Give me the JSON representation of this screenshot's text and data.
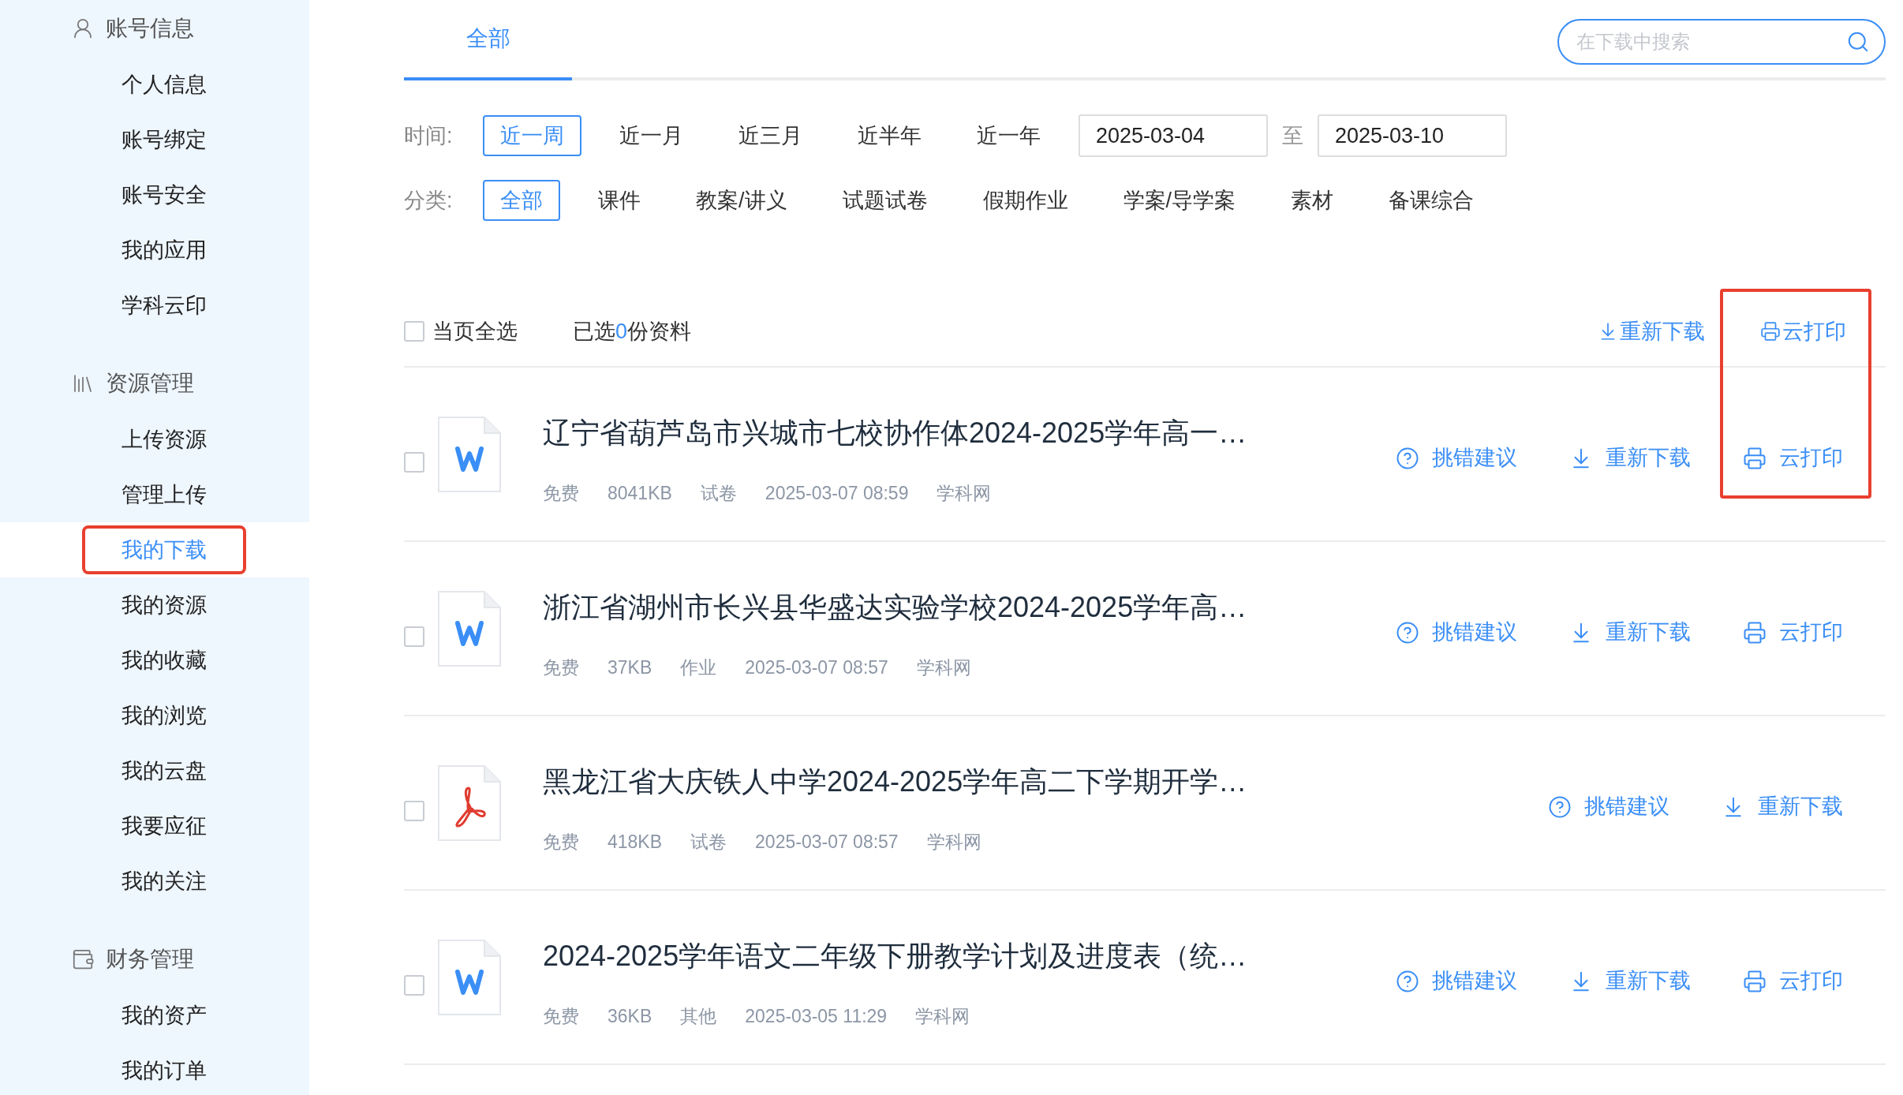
{
  "sidebar": {
    "sections": [
      {
        "kind": "account",
        "title": "账号信息",
        "items": [
          {
            "label": "个人信息",
            "selected": false,
            "highlighted": false
          },
          {
            "label": "账号绑定",
            "selected": false,
            "highlighted": false
          },
          {
            "label": "账号安全",
            "selected": false,
            "highlighted": false
          },
          {
            "label": "我的应用",
            "selected": false,
            "highlighted": false
          },
          {
            "label": "学科云印",
            "selected": false,
            "highlighted": false
          }
        ]
      },
      {
        "kind": "resources",
        "title": "资源管理",
        "items": [
          {
            "label": "上传资源",
            "selected": false,
            "highlighted": false
          },
          {
            "label": "管理上传",
            "selected": false,
            "highlighted": false
          },
          {
            "label": "我的下载",
            "selected": true,
            "highlighted": true
          },
          {
            "label": "我的资源",
            "selected": false,
            "highlighted": false
          },
          {
            "label": "我的收藏",
            "selected": false,
            "highlighted": false
          },
          {
            "label": "我的浏览",
            "selected": false,
            "highlighted": false
          },
          {
            "label": "我的云盘",
            "selected": false,
            "highlighted": false
          },
          {
            "label": "我要应征",
            "selected": false,
            "highlighted": false
          },
          {
            "label": "我的关注",
            "selected": false,
            "highlighted": false
          }
        ]
      },
      {
        "kind": "finance",
        "title": "财务管理",
        "items": [
          {
            "label": "我的资产",
            "selected": false,
            "highlighted": false
          },
          {
            "label": "我的订单",
            "selected": false,
            "highlighted": false
          }
        ]
      }
    ]
  },
  "tabs": [
    {
      "label": "全部",
      "selected": true
    }
  ],
  "search": {
    "placeholder": "在下载中搜索"
  },
  "filters": {
    "time": {
      "label": "时间:",
      "options": [
        {
          "label": "近一周",
          "selected": true
        },
        {
          "label": "近一月",
          "selected": false
        },
        {
          "label": "近三月",
          "selected": false
        },
        {
          "label": "近半年",
          "selected": false
        },
        {
          "label": "近一年",
          "selected": false
        }
      ],
      "date_from": "2025-03-04",
      "date_sep": "至",
      "date_to": "2025-03-10"
    },
    "category": {
      "label": "分类:",
      "options": [
        {
          "label": "全部",
          "selected": true
        },
        {
          "label": "课件",
          "selected": false
        },
        {
          "label": "教案/讲义",
          "selected": false
        },
        {
          "label": "试题试卷",
          "selected": false
        },
        {
          "label": "假期作业",
          "selected": false
        },
        {
          "label": "学案/导学案",
          "selected": false
        },
        {
          "label": "素材",
          "selected": false
        },
        {
          "label": "备课综合",
          "selected": false
        }
      ]
    }
  },
  "toolbar": {
    "select_all": {
      "label": "当页全选",
      "checked": false
    },
    "selected_prefix": "已选",
    "selected_count": "0",
    "selected_suffix": "份资料",
    "redownload": "重新下载",
    "print": "云打印"
  },
  "print_column_highlighted": true,
  "files": [
    {
      "kind": "word",
      "checked": false,
      "title": "辽宁省葫芦岛市兴城市七校协作体2024-2025学年高一…",
      "meta": [
        "免费",
        "8041KB",
        "试卷",
        "2025-03-07 08:59",
        "学科网"
      ],
      "actions": [
        {
          "kind": "report",
          "label": "挑错建议"
        },
        {
          "kind": "download",
          "label": "重新下载"
        },
        {
          "kind": "print",
          "label": "云打印"
        }
      ]
    },
    {
      "kind": "word",
      "checked": false,
      "title": "浙江省湖州市长兴县华盛达实验学校2024-2025学年高…",
      "meta": [
        "免费",
        "37KB",
        "作业",
        "2025-03-07 08:57",
        "学科网"
      ],
      "actions": [
        {
          "kind": "report",
          "label": "挑错建议"
        },
        {
          "kind": "download",
          "label": "重新下载"
        },
        {
          "kind": "print",
          "label": "云打印"
        }
      ]
    },
    {
      "kind": "pdf",
      "checked": false,
      "title": "黑龙江省大庆铁人中学2024-2025学年高二下学期开学…",
      "meta": [
        "免费",
        "418KB",
        "试卷",
        "2025-03-07 08:57",
        "学科网"
      ],
      "actions": [
        {
          "kind": "report",
          "label": "挑错建议"
        },
        {
          "kind": "download",
          "label": "重新下载"
        }
      ]
    },
    {
      "kind": "word",
      "checked": false,
      "title": "2024-2025学年语文二年级下册教学计划及进度表（统…",
      "meta": [
        "免费",
        "36KB",
        "其他",
        "2025-03-05 11:29",
        "学科网"
      ],
      "actions": [
        {
          "kind": "report",
          "label": "挑错建议"
        },
        {
          "kind": "download",
          "label": "重新下载"
        },
        {
          "kind": "print",
          "label": "云打印"
        }
      ]
    }
  ]
}
